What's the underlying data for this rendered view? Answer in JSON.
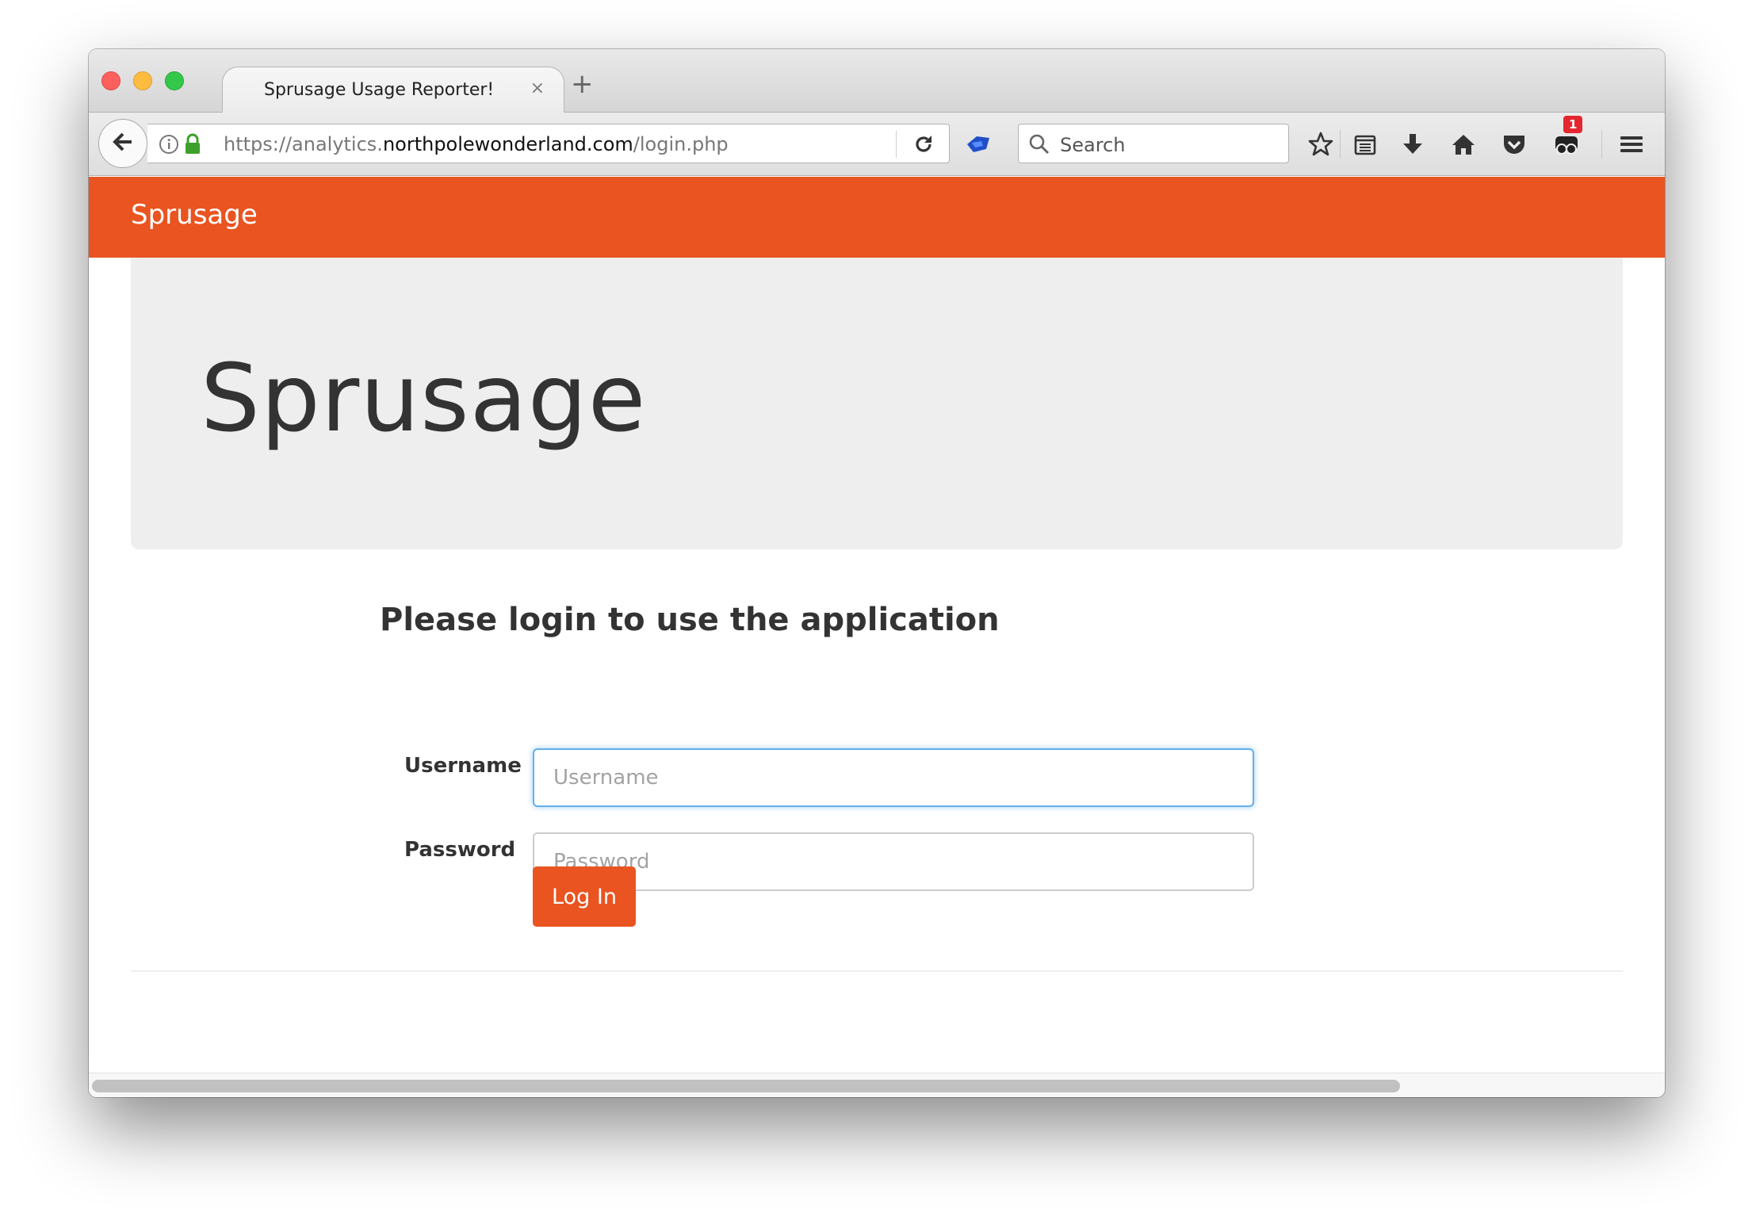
{
  "browser": {
    "tab_title": "Sprusage Usage Reporter!",
    "tab_close": "×",
    "new_tab": "+",
    "url_prefix": "https://analytics.",
    "url_host": "northpolewonderland.com",
    "url_path": "/login.php",
    "search_placeholder": "Search",
    "notification_count": "1",
    "icons": [
      "back-arrow-icon",
      "info-icon",
      "lock-icon",
      "reload-icon",
      "addon-icon",
      "search-icon",
      "bookmark-star-icon",
      "reading-list-icon",
      "download-icon",
      "home-icon",
      "pocket-icon",
      "extension-icon",
      "menu-icon"
    ]
  },
  "navbar": {
    "brand": "Sprusage",
    "color": "#e95420"
  },
  "jumbotron": {
    "title": "Sprusage"
  },
  "login": {
    "heading": "Please login to use the application",
    "username_label": "Username",
    "username_placeholder": "Username",
    "password_label": "Password",
    "password_placeholder": "Password",
    "submit_label": "Log In"
  }
}
